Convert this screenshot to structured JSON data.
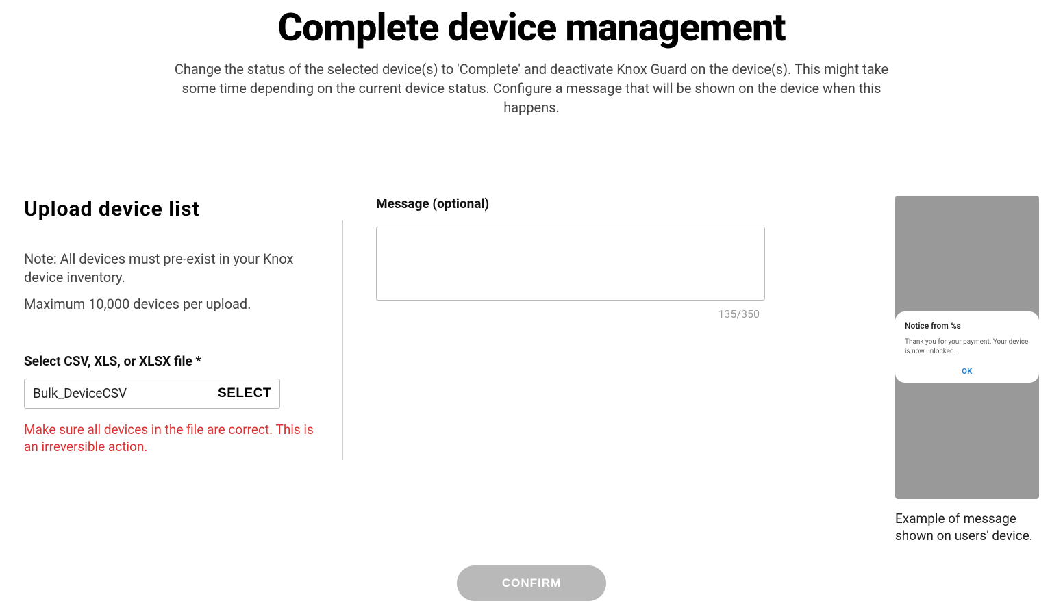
{
  "header": {
    "title": "Complete device management",
    "subtitle": "Change the status of the selected device(s) to 'Complete' and deactivate Knox Guard on the device(s). This might take some time depending on the current device status. Configure a message that will be shown on the device when this happens."
  },
  "upload": {
    "heading": "Upload device list",
    "note1": "Note: All devices must pre-exist in your Knox device inventory.",
    "note2": "Maximum 10,000 devices per upload.",
    "file_label": "Select CSV, XLS, or XLSX file *",
    "file_name": "Bulk_DeviceCSV",
    "select_label": "SELECT",
    "warning": "Make sure all devices in the file are correct. This is an irreversible action."
  },
  "message": {
    "label": "Message (optional)",
    "value": "",
    "char_count": "135/350"
  },
  "preview": {
    "dialog_title": "Notice from %s",
    "dialog_body": "Thank you for your payment. Your device is now unlocked.",
    "dialog_ok": "OK",
    "caption": "Example of message shown on users' device."
  },
  "footer": {
    "confirm_label": "CONFIRM"
  }
}
